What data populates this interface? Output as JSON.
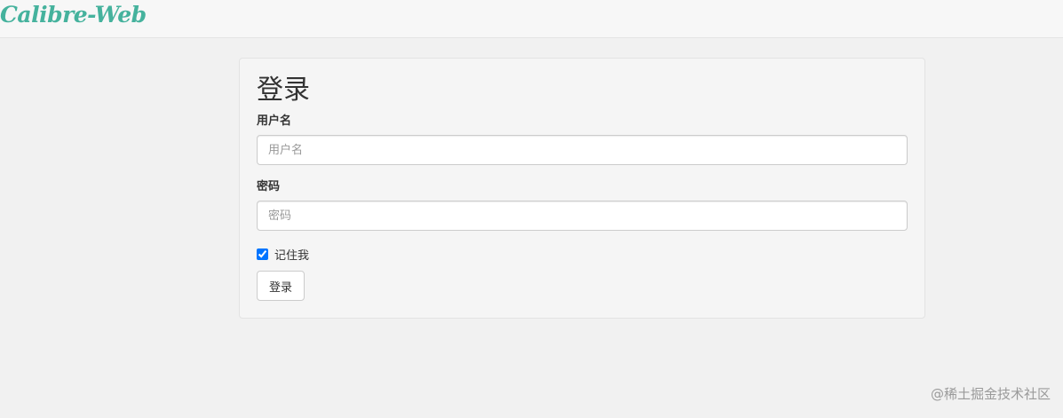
{
  "navbar": {
    "brand": "Calibre-Web"
  },
  "login": {
    "title": "登录",
    "username": {
      "label": "用户名",
      "placeholder": "用户名",
      "value": ""
    },
    "password": {
      "label": "密码",
      "placeholder": "密码",
      "value": ""
    },
    "remember_me": {
      "label": "记住我",
      "checked": true
    },
    "submit_label": "登录"
  },
  "watermark": "@稀土掘金技术社区",
  "colors": {
    "brand": "#45b29d",
    "page_background": "#f1f1f1",
    "panel_background": "#f5f5f5",
    "checkbox_accent": "#0075ff"
  }
}
